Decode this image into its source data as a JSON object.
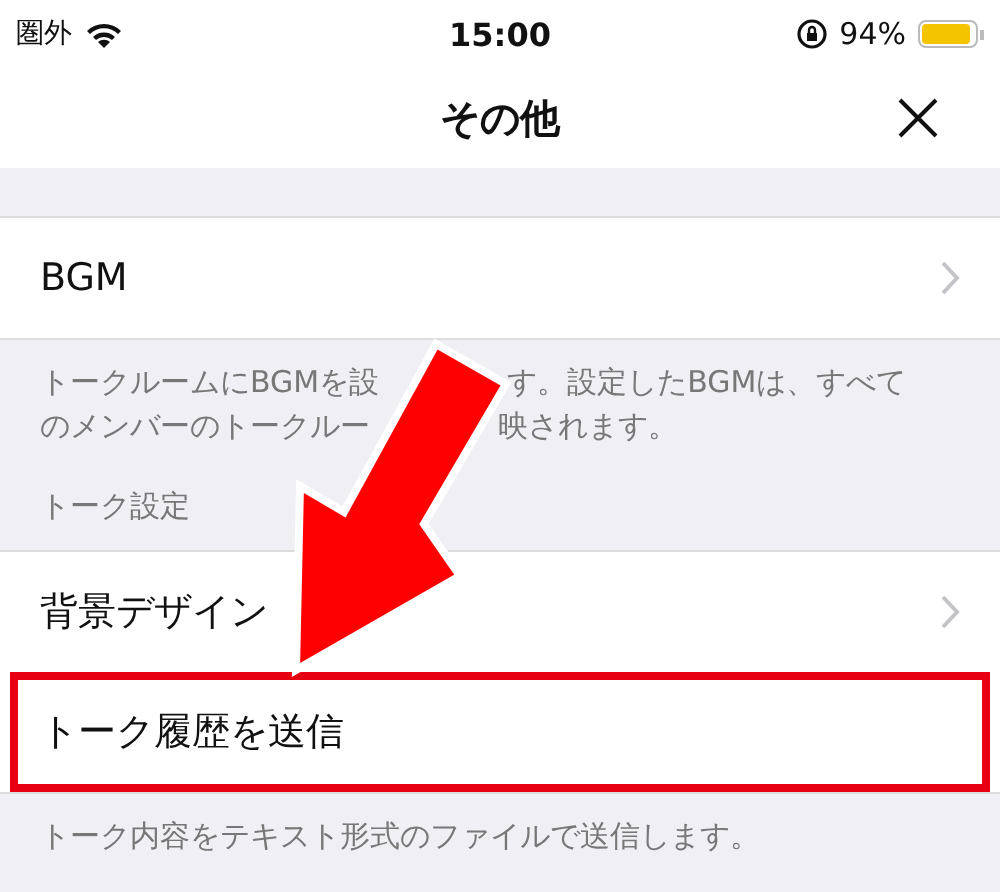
{
  "status_bar": {
    "carrier": "圏外",
    "time": "15:00",
    "battery_text": "94%"
  },
  "nav": {
    "title": "その他"
  },
  "sections": [
    {
      "rows": [
        {
          "label": "BGM",
          "chevron": true,
          "highlighted": false
        }
      ],
      "note_lines": [
        [
          "トークルームにBGMを設",
          "す。設定したBGMは、すべて"
        ],
        [
          "のメンバーのトークルー",
          "映されます。"
        ]
      ]
    },
    {
      "header": "トーク設定",
      "rows": [
        {
          "label": "背景デザイン",
          "chevron": true,
          "highlighted": false
        },
        {
          "label": "トーク履歴を送信",
          "chevron": false,
          "highlighted": true
        }
      ],
      "note_lines": [
        [
          "トーク内容をテキスト形式のファイルで送信します。"
        ]
      ]
    }
  ]
}
